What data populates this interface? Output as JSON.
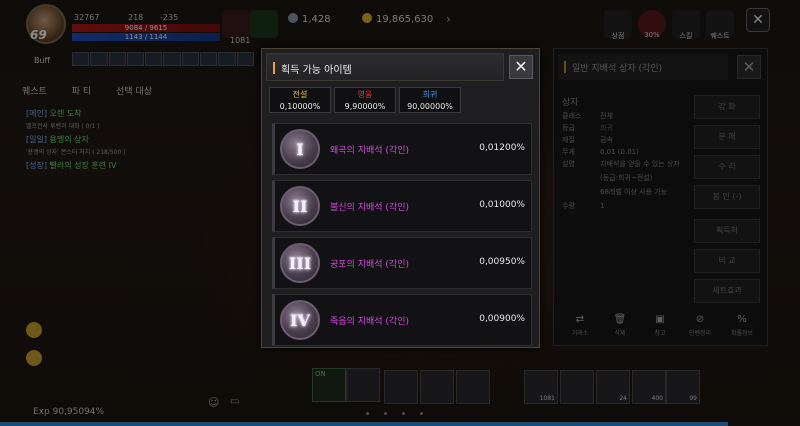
{
  "hud": {
    "level": "69",
    "combat_power": "32767",
    "stat_a": "218",
    "stat_b": "-235",
    "hp": "9084 / 9615",
    "mp": "1143 / 1144",
    "potion_count": "1081",
    "green_currency": "1,428",
    "gold": "19,865,630",
    "buff_label": "Buff",
    "menu": {
      "shop": "상점",
      "event_percent": "30%",
      "skill": "스킬",
      "quest": "퀘스트"
    }
  },
  "quest_panel": {
    "tabs": [
      "퀘스트",
      "파 티",
      "선택 대상"
    ],
    "quests": [
      {
        "tag": "[메인]",
        "title": "오렌 도착",
        "sub": "엘프전사 루벤과 대화 ( 0/1 )"
      },
      {
        "tag": "[일일]",
        "title": "용맹의 상자",
        "sub": "'용맹의 상자' 몬스터 처치 ( 218/500 )"
      },
      {
        "tag": "[성장]",
        "title": "빨라의 성장 훈련 IV",
        "sub": ""
      }
    ]
  },
  "modal": {
    "title": "획득 가능 아이템",
    "grades": [
      {
        "name": "전설",
        "value": "0,10000%",
        "color": "#e6c44a"
      },
      {
        "name": "영웅",
        "value": "9,90000%",
        "color": "#e04040"
      },
      {
        "name": "희귀",
        "value": "90,00000%",
        "color": "#4a9ae6"
      }
    ],
    "items": [
      {
        "roman": "I",
        "name": "왜곡의 지배석 (각인)",
        "pct": "0,01200%"
      },
      {
        "roman": "II",
        "name": "불신의 지배석 (각인)",
        "pct": "0,01000%"
      },
      {
        "roman": "III",
        "name": "공포의 지배석 (각인)",
        "pct": "0,00950%"
      },
      {
        "roman": "IV",
        "name": "죽음의 지배석 (각인)",
        "pct": "0,00900%"
      }
    ]
  },
  "right_panel": {
    "title": "일반 지배석 상자 (각인)",
    "section": "상자",
    "rows": [
      {
        "k": "클래스",
        "v": "전체"
      },
      {
        "k": "등급",
        "v": "희귀"
      },
      {
        "k": "재질",
        "v": "금속"
      },
      {
        "k": "무게",
        "v": "0,01 (0.01)"
      },
      {
        "k": "설명",
        "v": "지배석을 얻을 수 있는 상자"
      },
      {
        "k": "",
        "v": "(등급:희귀~전설)"
      },
      {
        "k": "",
        "v": "68레벨 이상 사용 가능"
      },
      {
        "k": "수량",
        "v": "1"
      }
    ],
    "side_buttons": [
      "강 화",
      "분 해",
      "수 리",
      "봉 인 (-)",
      "획득처",
      "비 교",
      "세트효과"
    ],
    "bottom_buttons": [
      "거래소",
      "삭제",
      "창고",
      "인벤정리",
      "확률정보"
    ]
  },
  "bottom": {
    "exp": "Exp 90,95094%",
    "exp_fraction": 0.9095,
    "auto_label": "ON",
    "slot_counts": [
      "",
      "",
      "",
      "",
      "1081",
      "",
      "24",
      "400",
      "99"
    ]
  }
}
